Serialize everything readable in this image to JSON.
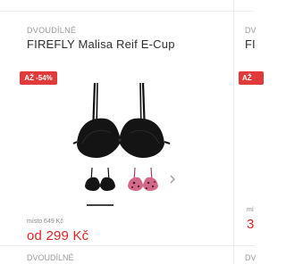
{
  "card": {
    "category": "DVOUDÍLNÉ",
    "title": "FIREFLY Malisa Reif E-Cup",
    "discount_badge": "AŽ -54%",
    "old_price": "místo 649 Kč",
    "new_price": "od 299 Kč",
    "thumbnails": [
      {
        "icon": "black-bra-thumbnail-icon"
      },
      {
        "icon": "pink-leopard-bra-thumbnail-icon"
      }
    ],
    "next_icon": "chevron-right-icon"
  },
  "next_card": {
    "category": "DV",
    "title": "FI",
    "discount_badge": "AŽ",
    "old_price": "mí",
    "new_price": "3"
  },
  "bottom": {
    "category": "DVOUDÍLNÉ",
    "next_category": "DV"
  },
  "colors": {
    "accent_red": "#e13a3a",
    "price_red": "#e02424",
    "muted_text": "#9a9a9a"
  }
}
